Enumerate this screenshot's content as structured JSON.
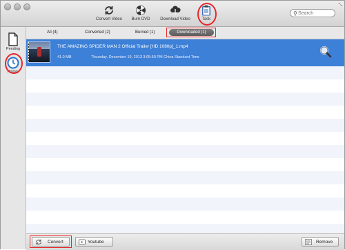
{
  "toolbar": {
    "items": [
      {
        "label": "Convert Video",
        "icon": "convert-icon"
      },
      {
        "label": "Burn DVD",
        "icon": "burn-dvd-icon"
      },
      {
        "label": "Download Video",
        "icon": "download-cloud-icon"
      },
      {
        "label": "Task",
        "icon": "task-clipboard-icon"
      }
    ],
    "search_placeholder": "Search"
  },
  "sidebar": {
    "items": [
      {
        "label": "Pending",
        "icon": "document-icon"
      },
      {
        "label": "History",
        "icon": "history-clock-icon"
      }
    ]
  },
  "tabs": [
    {
      "label": "All (4)"
    },
    {
      "label": "Converted (2)"
    },
    {
      "label": "Burned (1)"
    },
    {
      "label": "Downloaded (1)"
    }
  ],
  "list": {
    "rows": [
      {
        "filename": "THE AMAZING SPIDER MAN 2 Official Trailer [HD 1080p]_1.mp4",
        "size": "41.0 MB",
        "date": "Thursday, December 19, 2013 3:05:59 PM China Standard Time"
      }
    ]
  },
  "bottom": {
    "convert_label": "Convert",
    "youtube_label": "Youtube",
    "remove_label": "Remove"
  },
  "colors": {
    "selection": "#3d80d8",
    "highlight_annotation": "#e8262a"
  }
}
